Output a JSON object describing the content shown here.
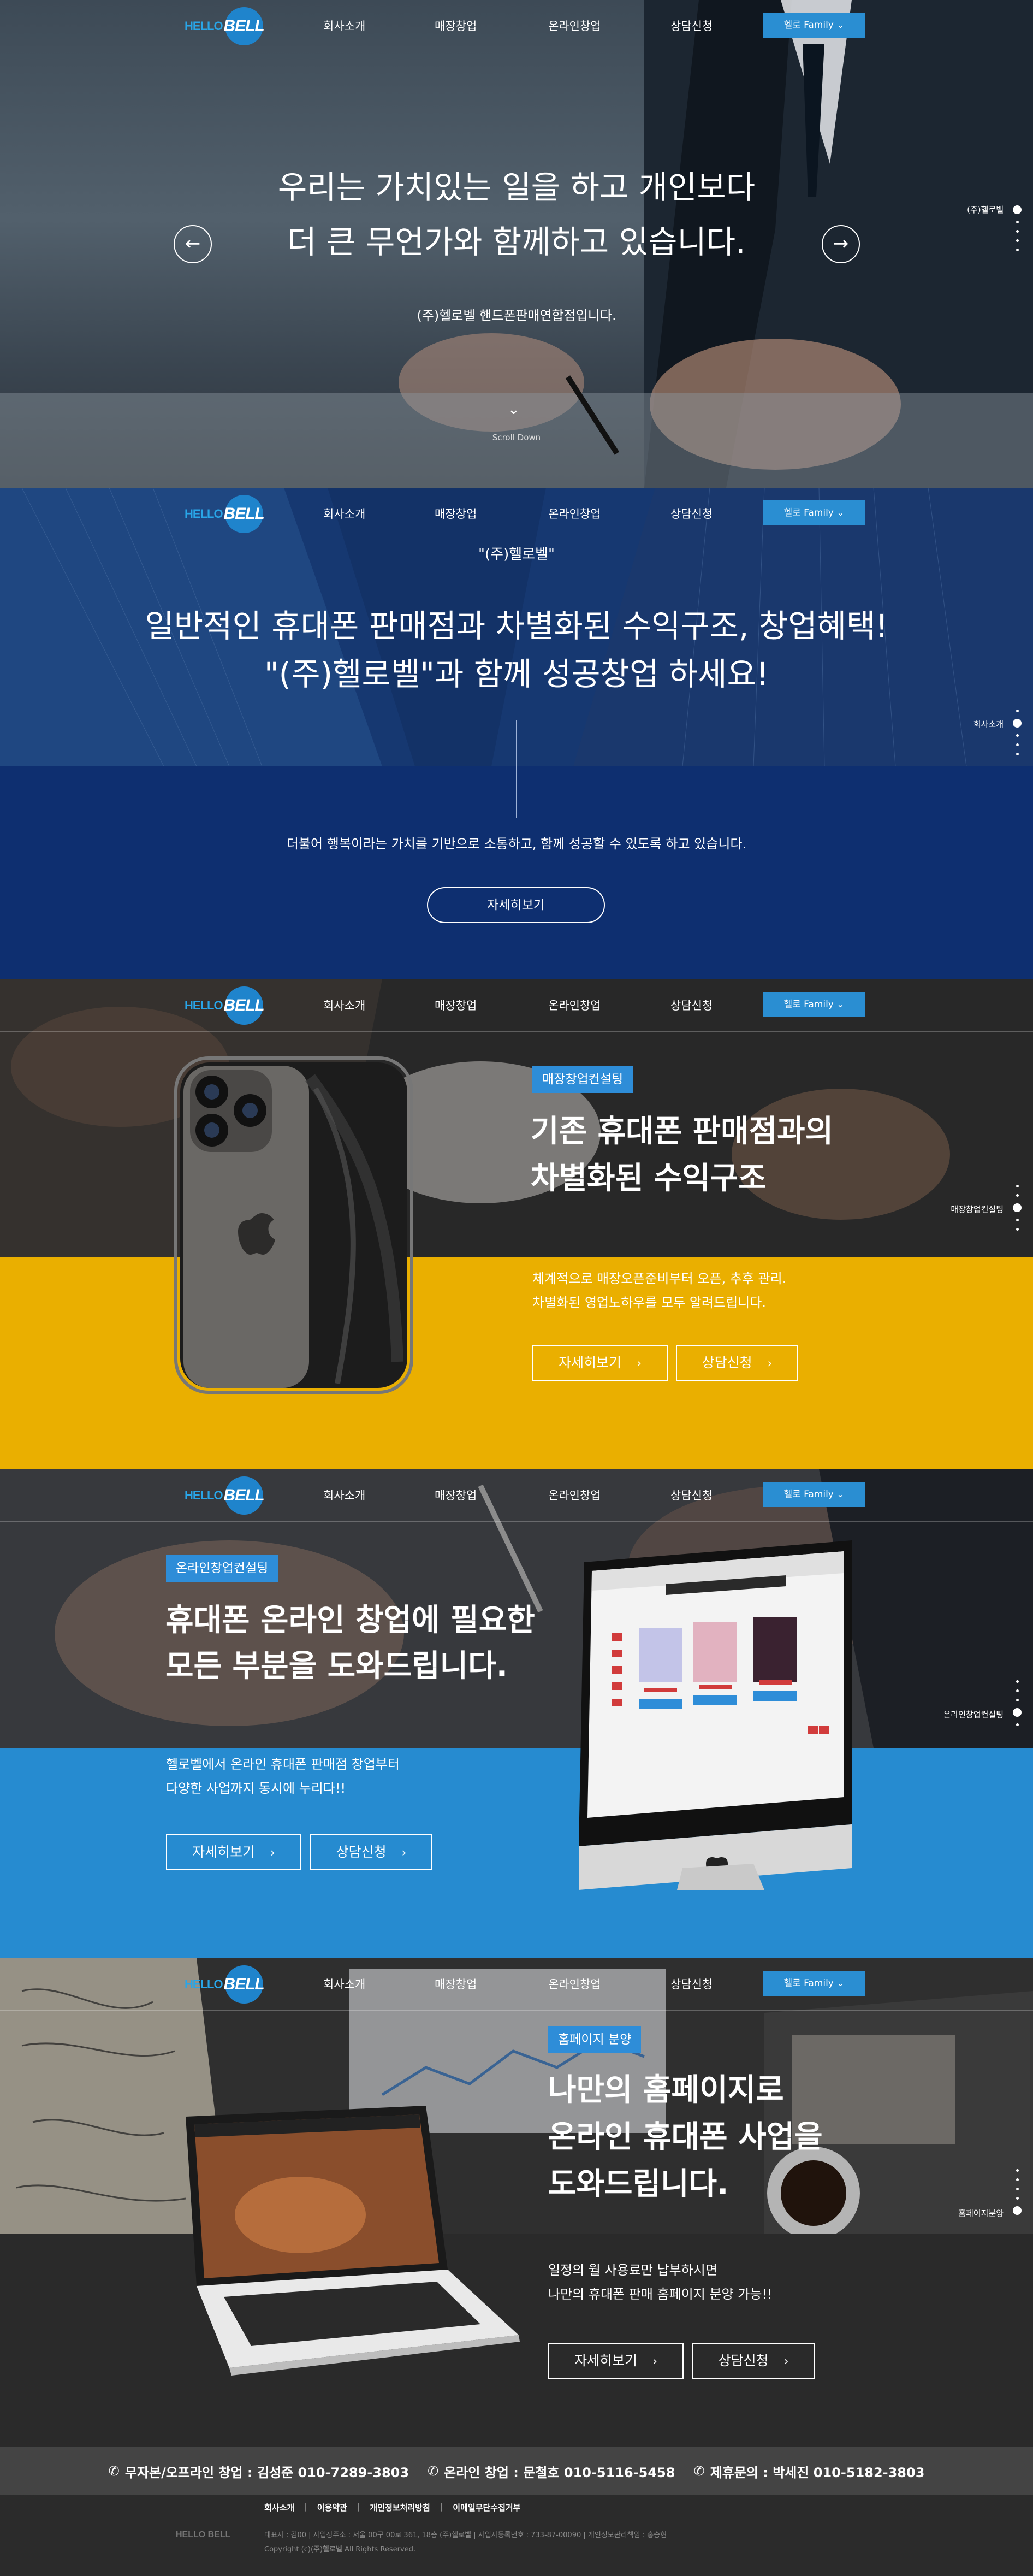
{
  "nav": {
    "logo_hello": "HELLO",
    "logo_bell": "BELL",
    "items": [
      "회사소개",
      "매장창업",
      "온라인창업",
      "상담신청"
    ],
    "family_button": "헬로 Family",
    "family_arrow": "chevron-down-icon"
  },
  "hero": {
    "line1": "우리는 가치있는 일을 하고 개인보다",
    "line2": "더 큰 무언가와 함께하고 있습니다.",
    "sub": "(주)헬로벨 핸드폰판매연합점입니다.",
    "scroll_label": "Scroll Down",
    "side_label": "(주)헬로벨",
    "prev_icon": "arrow-left-icon",
    "next_icon": "arrow-right-icon"
  },
  "about": {
    "kicker": "\"(주)헬로벨\"",
    "line1": "일반적인 휴대폰 판매점과 차별화된 수익구조, 창업혜택!",
    "line2": "\"(주)헬로벨\"과 함께 성공창업 하세요!",
    "desc": "더불어 행복이라는 가치를 기반으로 소통하고, 함께 성공할 수 있도록 하고 있습니다.",
    "button": "자세히보기",
    "side_label": "회사소개"
  },
  "store": {
    "tag": "매장창업컨설팅",
    "line1": "기존 휴대폰 판매점과의",
    "line2": "차별화된 수익구조",
    "desc1": "체계적으로 매장오픈준비부터 오픈, 추후 관리.",
    "desc2": "차별화된 영업노하우를 모두 알려드립니다.",
    "btn_more": "자세히보기",
    "btn_consult": "상담신청",
    "side_label": "매장창업컨설팅"
  },
  "online": {
    "tag": "온라인창업컨설팅",
    "line1": "휴대폰 온라인 창업에 필요한",
    "line2": "모든 부분을 도와드립니다.",
    "desc1": "헬로벨에서 온라인 휴대폰 판매점 창업부터",
    "desc2": "다양한 사업까지 동시에 누리다!!",
    "btn_more": "자세히보기",
    "btn_consult": "상담신청",
    "side_label": "온라인창업컨설팅"
  },
  "homepage": {
    "tag": "홈페이지 분양",
    "line1": "나만의 홈페이지로",
    "line2": "온라인 휴대폰 사업을",
    "line3": "도와드립니다.",
    "desc1": "일정의 월 사용료만 납부하시면",
    "desc2": "나만의 휴대폰 판매 홈페이지 분양 가능!!",
    "btn_more": "자세히보기",
    "btn_consult": "상담신청",
    "side_label": "홈페이지분양"
  },
  "contact": {
    "items": [
      "무자본/오프라인 창업 : 김성준 010-7289-3803",
      "온라인 창업 : 문철호 010-5116-5458",
      "제휴문의 : 박세진 010-5182-3803"
    ],
    "icon": "phone-icon"
  },
  "footer": {
    "links": [
      "회사소개",
      "이용약관",
      "개인정보처리방침",
      "이메일무단수집거부"
    ],
    "logo": "HELLO BELL",
    "info": "대표자 : 김00 | 사업장주소 : 서울 00구 00로 361, 18층 (주)헬로벨 | 사업자등록번호 : 733-87-00090 | 개인정보관리책임 : 홍승현",
    "copyright": "Copyright (c)(주)헬로벨 All Rights Reserved."
  },
  "colors": {
    "accent_blue": "#2a8ed2",
    "navy": "#0d2d6b",
    "yellow": "#eaaf00",
    "sky": "#268bd0",
    "dark": "#2a2a2a"
  }
}
